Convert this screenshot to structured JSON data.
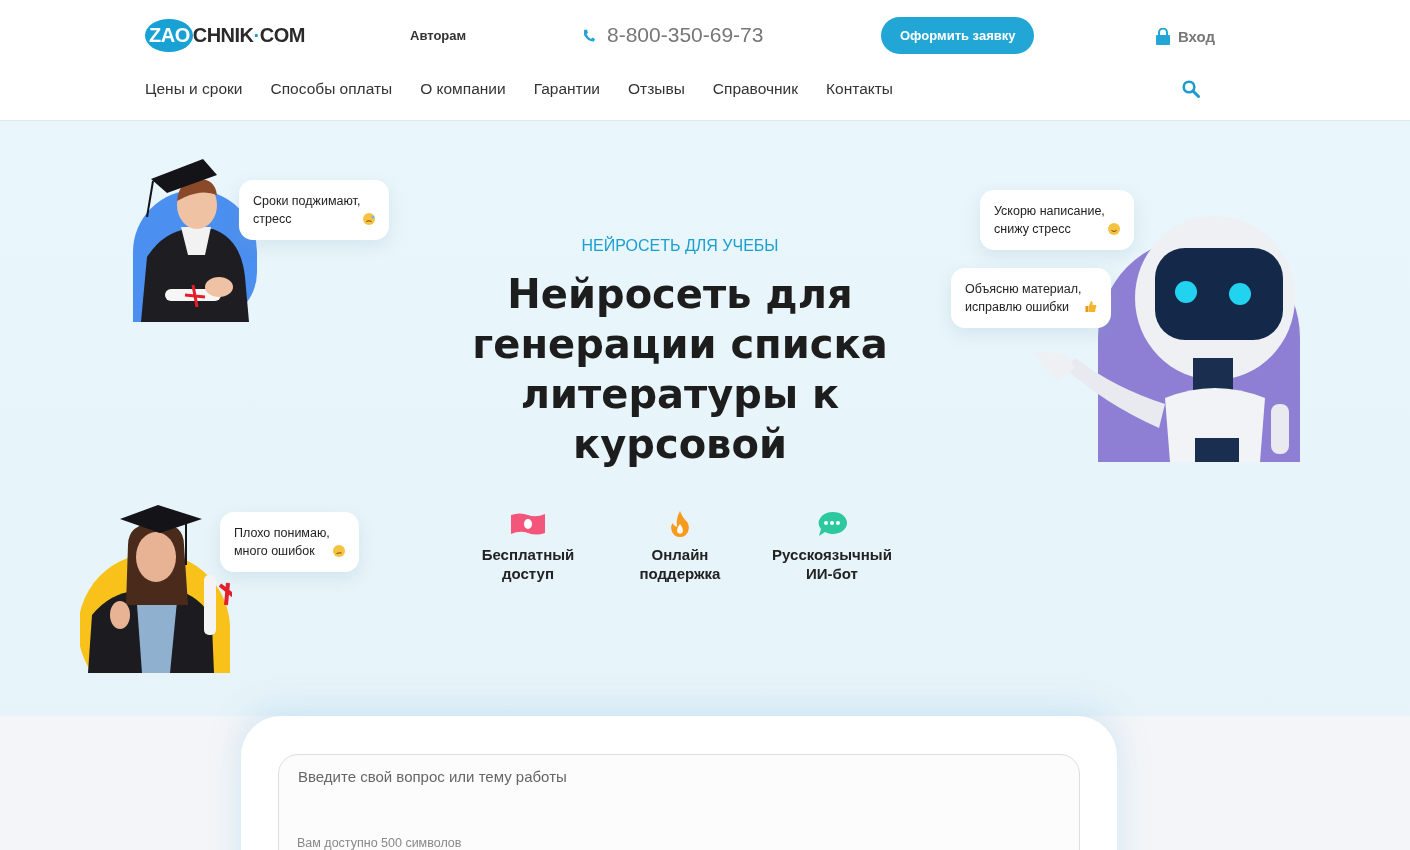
{
  "header": {
    "logo": {
      "badge": "ZAO",
      "rest": "CHNIK",
      "dot": "·",
      "suffix": "COM"
    },
    "authors_link": "Авторам",
    "phone": "8-800-350-69-73",
    "order_button": "Оформить заявку",
    "login": "Вход",
    "nav": [
      "Цены и сроки",
      "Способы оплаты",
      "О компании",
      "Гарантии",
      "Отзывы",
      "Справочник",
      "Контакты"
    ]
  },
  "hero": {
    "eyebrow": "НЕЙРОСЕТЬ ДЛЯ УЧЕБЫ",
    "title": "Нейросеть для генерации списка литературы к курсовой",
    "left_bubbles": [
      {
        "text": "Сроки поджимают,\nстресс",
        "kind": "sweat"
      },
      {
        "text": "Плохо понимаю,\nмного ошибок",
        "kind": "confused"
      }
    ],
    "robot_bubbles": [
      {
        "text": "Ускорю написание,\nснижу стресс",
        "kind": "relieved"
      },
      {
        "text": "Объясню материал,\nисправлю ошибки",
        "kind": "thumbs"
      }
    ],
    "features": [
      {
        "kind": "money",
        "label": "Бесплатный\nдоступ"
      },
      {
        "kind": "fire",
        "label": "Онлайн\nподдержка"
      },
      {
        "kind": "chat",
        "label": "Русскоязычный\nИИ-бот"
      }
    ]
  },
  "form": {
    "question": {
      "placeholder": "Введите свой вопрос или тему работы"
    },
    "counter": "Вам доступно 500 символов"
  }
}
